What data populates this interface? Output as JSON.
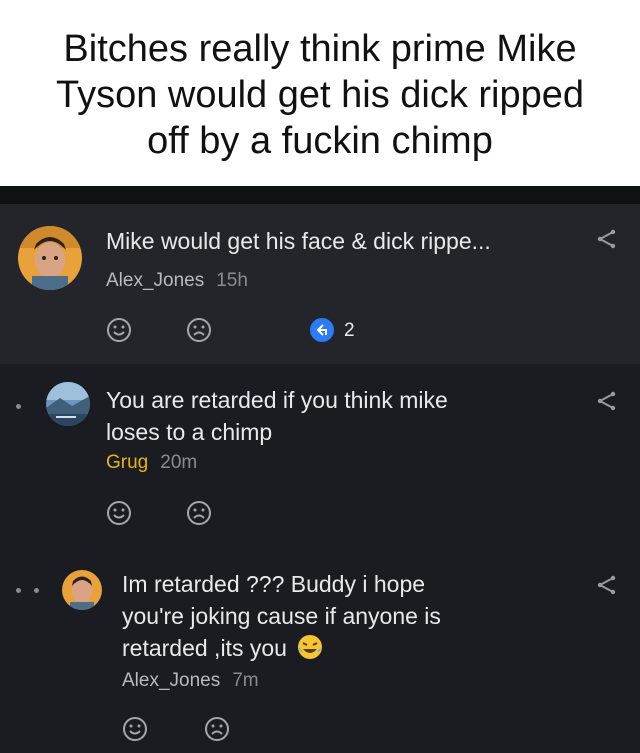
{
  "caption": {
    "line1": "Bitches really think prime Mike",
    "line2": "Tyson would get his dick ripped",
    "line3": "off by a fuckin chimp"
  },
  "post": {
    "title": "Mike would get his face & dick rippe...",
    "author": "Alex_Jones",
    "time": "15h",
    "reply_count": "2"
  },
  "reply1": {
    "line1": "You are retarded if you think mike",
    "line2": "loses to a chimp",
    "author": "Grug",
    "time": "20m"
  },
  "reply2": {
    "line1": "Im retarded ??? Buddy i hope",
    "line2": "you're joking cause if anyone is",
    "line3": "retarded ,its you",
    "author": "Alex_Jones",
    "time": "7m"
  },
  "colors": {
    "background": "#1b1c21",
    "post_background": "#24252b",
    "accent_blue": "#2d7cf6",
    "grug_gold": "#e8b21a"
  }
}
